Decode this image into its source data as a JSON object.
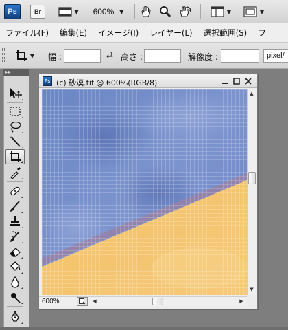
{
  "app": {
    "logo_text": "Ps",
    "bridge_label": "Br",
    "zoom_value": "600%"
  },
  "menu": {
    "items": [
      "ファイル(F)",
      "編集(E)",
      "イメージ(I)",
      "レイヤー(L)",
      "選択範囲(S)",
      "フ"
    ]
  },
  "options": {
    "width_label": "幅 :",
    "width_value": "",
    "height_label": "高さ :",
    "height_value": "",
    "resolution_label": "解像度 :",
    "resolution_value": "",
    "unit_value": "pixel/"
  },
  "document": {
    "icon_text": "Ps",
    "title": "(c) 砂漠.tif @ 600%(RGB/8)",
    "status_zoom": "600%",
    "scroll": {
      "vertical_position": 0.41,
      "horizontal_position": 0.45
    },
    "colors": {
      "sky_blue": "#6f8ac6",
      "sky_blue_dark": "#5a72b6",
      "sand_yellow": "#f3c36c",
      "sand_light": "#f7cf7e",
      "edge_purple": "#9a84a8",
      "pixel_grid": "#ffffff"
    }
  },
  "tools": [
    {
      "icon": "move-tool-icon"
    },
    {
      "icon": "marquee-tool-icon"
    },
    {
      "icon": "lasso-tool-icon"
    },
    {
      "icon": "magic-wand-tool-icon"
    },
    {
      "icon": "crop-tool-icon",
      "active": true
    },
    {
      "icon": "eyedropper-tool-icon"
    },
    {
      "icon": "healing-brush-tool-icon"
    },
    {
      "icon": "brush-tool-icon"
    },
    {
      "icon": "clone-stamp-tool-icon"
    },
    {
      "icon": "history-brush-tool-icon"
    },
    {
      "icon": "eraser-tool-icon"
    },
    {
      "icon": "paint-bucket-tool-icon"
    },
    {
      "icon": "blur-tool-icon"
    },
    {
      "icon": "dodge-tool-icon"
    },
    {
      "icon": "pen-tool-icon"
    }
  ]
}
